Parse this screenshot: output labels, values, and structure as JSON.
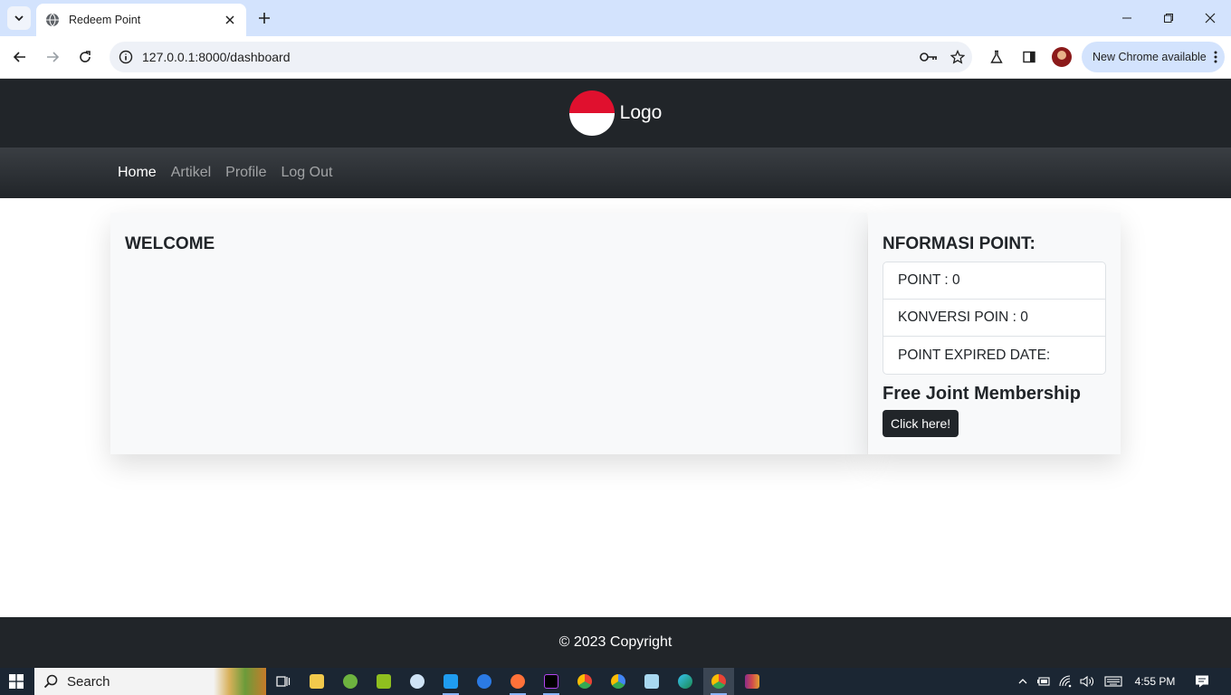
{
  "browser": {
    "tab": {
      "title": "Redeem Point"
    },
    "address": {
      "url": "127.0.0.1:8000/dashboard"
    },
    "update_button": "New Chrome available"
  },
  "site": {
    "logo_text": "Logo",
    "nav": [
      {
        "label": "Home",
        "active": true
      },
      {
        "label": "Artikel",
        "active": false
      },
      {
        "label": "Profile",
        "active": false
      },
      {
        "label": "Log Out",
        "active": false
      }
    ],
    "welcome_heading": "WELCOME",
    "point_info": {
      "heading": "NFORMASI POINT:",
      "items": [
        "POINT : 0",
        "KONVERSI POIN : 0",
        "POINT EXPIRED DATE:"
      ]
    },
    "membership": {
      "heading": "Free Joint Membership",
      "button_label": "Click here!"
    },
    "footer_text": "© 2023 Copyright"
  },
  "taskbar": {
    "search_label": "Search",
    "clock": "4:55 PM"
  },
  "colors": {
    "header_bg": "#212529",
    "logo_red": "#e0102e",
    "tabstrip_bg": "#d3e3fd",
    "taskbar_bg": "#1b2633"
  }
}
